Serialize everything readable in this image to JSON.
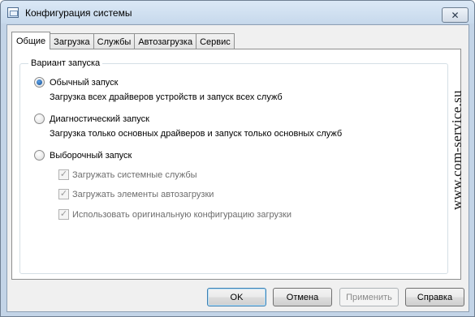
{
  "window": {
    "title": "Конфигурация системы",
    "close_glyph": "✕"
  },
  "tabs": [
    {
      "label": "Общие",
      "active": true
    },
    {
      "label": "Загрузка",
      "active": false
    },
    {
      "label": "Службы",
      "active": false
    },
    {
      "label": "Автозагрузка",
      "active": false
    },
    {
      "label": "Сервис",
      "active": false
    }
  ],
  "startup": {
    "caption": "Вариант запуска",
    "normal": {
      "label": "Обычный запуск",
      "desc": "Загрузка всех драйверов устройств и запуск всех служб",
      "checked": true
    },
    "diagnostic": {
      "label": "Диагностический запуск",
      "desc": "Загрузка только основных драйверов и запуск только основных служб",
      "checked": false
    },
    "selective": {
      "label": "Выборочный запуск",
      "checked": false,
      "options": [
        {
          "label": "Загружать системные службы",
          "checked": true,
          "disabled": true
        },
        {
          "label": "Загружать элементы автозагрузки",
          "checked": true,
          "disabled": true
        },
        {
          "label": "Использовать оригинальную конфигурацию загрузки",
          "checked": true,
          "disabled": true
        }
      ]
    }
  },
  "buttons": {
    "ok": "OK",
    "cancel": "Отмена",
    "apply": "Применить",
    "help": "Справка"
  },
  "watermark": "www.com-service.su",
  "colors": {
    "title_bar": "#c7d9ec",
    "accent": "#124f92",
    "disabled_text": "#6d6d6d"
  }
}
